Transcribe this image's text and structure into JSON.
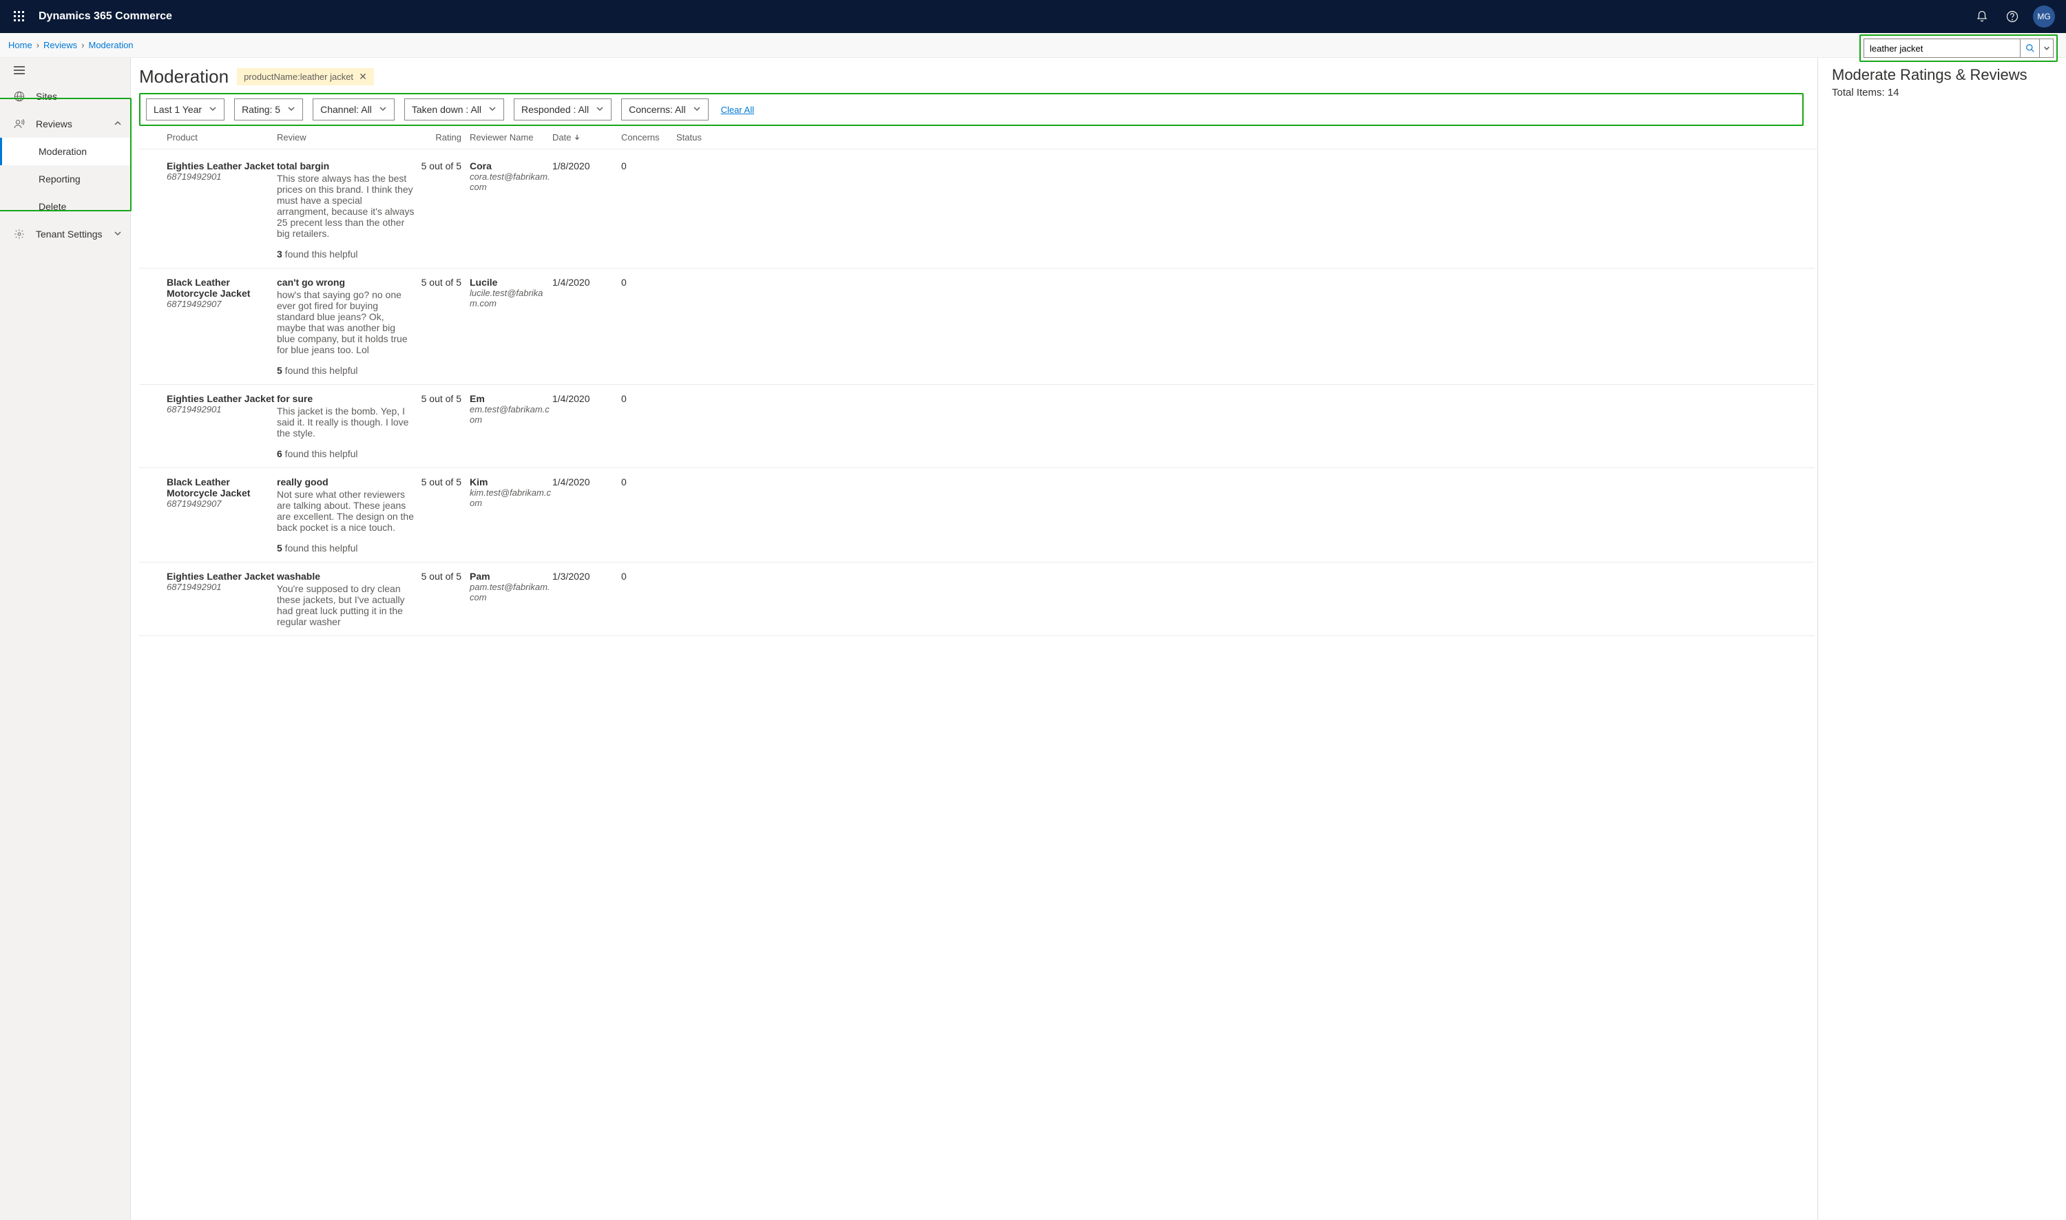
{
  "app_title": "Dynamics 365 Commerce",
  "avatar_initials": "MG",
  "breadcrumbs": [
    "Home",
    "Reviews",
    "Moderation"
  ],
  "search": {
    "value": "leather jacket"
  },
  "sidebar": {
    "sites": "Sites",
    "reviews": "Reviews",
    "moderation": "Moderation",
    "reporting": "Reporting",
    "delete": "Delete",
    "tenant_settings": "Tenant Settings"
  },
  "page": {
    "title": "Moderation",
    "chip": "productName:leather jacket"
  },
  "filters": {
    "date": "Last 1 Year",
    "rating": "Rating: 5",
    "channel": "Channel: All",
    "taken_down": "Taken down : All",
    "responded": "Responded : All",
    "concerns": "Concerns: All",
    "clear_all": "Clear All"
  },
  "columns": {
    "product": "Product",
    "review": "Review",
    "rating": "Rating",
    "reviewer": "Reviewer Name",
    "date": "Date",
    "concerns": "Concerns",
    "status": "Status"
  },
  "helpful_suffix": " found this helpful",
  "rows": [
    {
      "product": "Eighties Leather Jacket",
      "sku": "68719492901",
      "title": "total bargin",
      "body": "This store always has the best prices on this brand. I think they must have a special arrangment, because it's always 25 precent less than the other big retailers.",
      "helpful": "3",
      "rating": "5 out of 5",
      "reviewer": "Cora",
      "email": "cora.test@fabrikam.com",
      "date": "1/8/2020",
      "concerns": "0"
    },
    {
      "product": "Black Leather Motorcycle Jacket",
      "sku": "68719492907",
      "title": "can't go wrong",
      "body": "how's that saying go? no one ever got fired for buying standard blue jeans? Ok, maybe that was another big blue company, but it holds true for blue jeans too. Lol",
      "helpful": "5",
      "rating": "5 out of 5",
      "reviewer": "Lucile",
      "email": "lucile.test@fabrikam.com",
      "date": "1/4/2020",
      "concerns": "0"
    },
    {
      "product": "Eighties Leather Jacket",
      "sku": "68719492901",
      "title": "for sure",
      "body": "This jacket is the bomb. Yep, I said it. It really is though. I love the style.",
      "helpful": "6",
      "rating": "5 out of 5",
      "reviewer": "Em",
      "email": "em.test@fabrikam.com",
      "date": "1/4/2020",
      "concerns": "0"
    },
    {
      "product": "Black Leather Motorcycle Jacket",
      "sku": "68719492907",
      "title": "really good",
      "body": "Not sure what other reviewers are talking about. These jeans are excellent. The design on the back pocket is a nice touch.",
      "helpful": "5",
      "rating": "5 out of 5",
      "reviewer": "Kim",
      "email": "kim.test@fabrikam.com",
      "date": "1/4/2020",
      "concerns": "0"
    },
    {
      "product": "Eighties Leather Jacket",
      "sku": "68719492901",
      "title": "washable",
      "body": "You're supposed to dry clean these jackets, but I've actually had great luck putting it in the regular washer",
      "helpful": "",
      "rating": "5 out of 5",
      "reviewer": "Pam",
      "email": "pam.test@fabrikam.com",
      "date": "1/3/2020",
      "concerns": "0"
    }
  ],
  "right_panel": {
    "title": "Moderate Ratings & Reviews",
    "total_label": "Total Items: ",
    "total_value": "14"
  }
}
